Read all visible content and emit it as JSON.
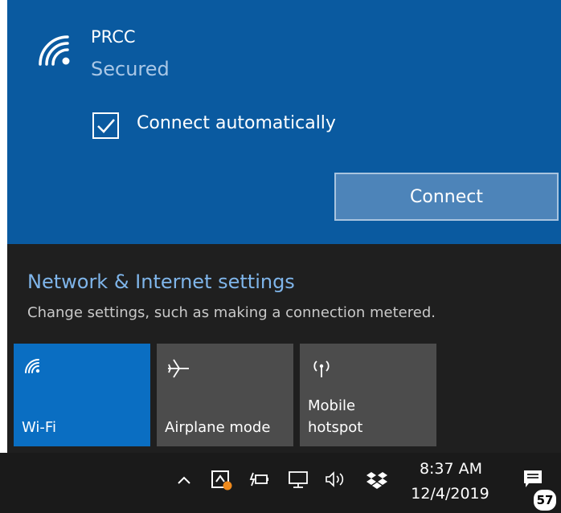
{
  "network": {
    "name": "PRCC",
    "status": "Secured",
    "auto_connect_label": "Connect automatically",
    "auto_connect_checked": true,
    "connect_label": "Connect"
  },
  "settings": {
    "link": "Network & Internet settings",
    "description": "Change settings, such as making a connection metered."
  },
  "tiles": [
    {
      "label": "Wi-Fi",
      "icon": "wifi-icon",
      "active": true
    },
    {
      "label": "Airplane mode",
      "icon": "airplane-icon",
      "active": false
    },
    {
      "label": "Mobile hotspot",
      "icon": "hotspot-icon",
      "active": false
    }
  ],
  "taskbar": {
    "time": "8:37 AM",
    "date": "12/4/2019",
    "notification_count": "57",
    "icons": [
      "chevron-up-icon",
      "app-tray-icon",
      "battery-icon",
      "network-icon",
      "volume-icon",
      "dropbox-icon",
      "action-center-icon"
    ]
  },
  "colors": {
    "network_item_bg": "#0a5aa0",
    "panel_bg": "#1f1f1f",
    "active_tile": "#0a6ec2",
    "inactive_tile": "#4c4c4c",
    "link": "#7fb5ea"
  }
}
